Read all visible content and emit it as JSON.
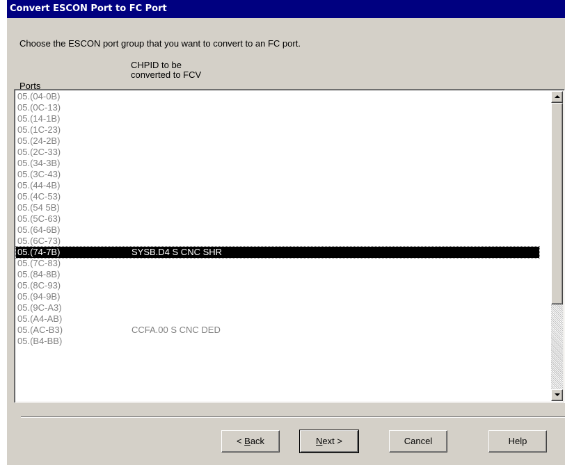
{
  "dialog": {
    "title": "Convert ESCON Port to FC Port",
    "instruction": "Choose the ESCON port group that you want to convert to an FC port."
  },
  "list": {
    "columns": {
      "ports": "Ports",
      "chpid_line1": "CHPID to be",
      "chpid_line2": "converted to FCV"
    },
    "rows": [
      {
        "port": "05.(04-0B)",
        "chpid": ""
      },
      {
        "port": "05.(0C-13)",
        "chpid": ""
      },
      {
        "port": "05.(14-1B)",
        "chpid": ""
      },
      {
        "port": "05.(1C-23)",
        "chpid": ""
      },
      {
        "port": "05.(24-2B)",
        "chpid": ""
      },
      {
        "port": "05.(2C-33)",
        "chpid": ""
      },
      {
        "port": "05.(34-3B)",
        "chpid": ""
      },
      {
        "port": "05.(3C-43)",
        "chpid": ""
      },
      {
        "port": "05.(44-4B)",
        "chpid": ""
      },
      {
        "port": "05.(4C-53)",
        "chpid": ""
      },
      {
        "port": "05.(54 5B)",
        "chpid": ""
      },
      {
        "port": "05.(5C-63)",
        "chpid": ""
      },
      {
        "port": "05.(64-6B)",
        "chpid": ""
      },
      {
        "port": "05.(6C-73)",
        "chpid": ""
      },
      {
        "port": "05.(74-7B)",
        "chpid": "SYSB.D4 S CNC SHR",
        "selected": true
      },
      {
        "port": "05.(7C-83)",
        "chpid": ""
      },
      {
        "port": "05.(84-8B)",
        "chpid": ""
      },
      {
        "port": "05.(8C-93)",
        "chpid": ""
      },
      {
        "port": "05.(94-9B)",
        "chpid": ""
      },
      {
        "port": "05.(9C-A3)",
        "chpid": ""
      },
      {
        "port": "05.(A4-AB)",
        "chpid": ""
      },
      {
        "port": "05.(AC-B3)",
        "chpid": "CCFA.00 S CNC DED"
      },
      {
        "port": "05.(B4-BB)",
        "chpid": ""
      }
    ]
  },
  "scrollbar": {
    "up_icon": "scroll-up-arrow-icon",
    "down_icon": "scroll-down-arrow-icon"
  },
  "buttons": {
    "back": {
      "mnemonic": "B",
      "rest": "ack",
      "prefix": "< "
    },
    "next": {
      "mnemonic": "N",
      "rest": "ext",
      "suffix": " >"
    },
    "cancel": "Cancel",
    "help": "Help"
  },
  "colors": {
    "titlebar": "#000080",
    "dialog_bg": "#d4d0c8",
    "selection_bg": "#000000",
    "item_text": "#808080"
  }
}
